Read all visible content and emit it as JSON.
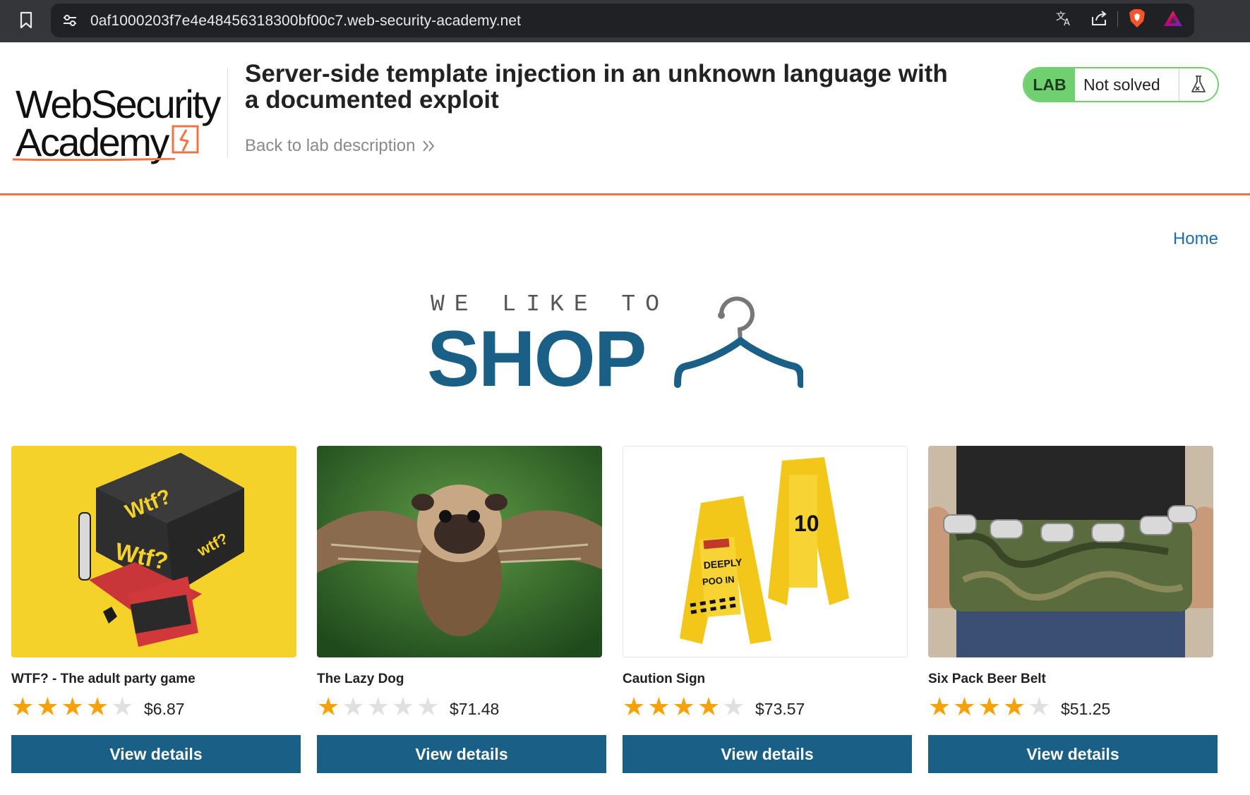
{
  "browser": {
    "url": "0af1000203f7e4e48456318300bf00c7.web-security-academy.net"
  },
  "lab": {
    "logo_line1": "WebSecurity",
    "logo_line2": "Academy",
    "title": "Server-side template injection in an unknown language with a documented exploit",
    "back_link": "Back to lab description",
    "badge_label": "LAB",
    "status": "Not solved"
  },
  "nav": {
    "home": "Home"
  },
  "banner": {
    "tagline": "WE LIKE TO",
    "word": "SHOP"
  },
  "products": [
    {
      "name": "WTF? - The adult party game",
      "rating": 4,
      "price": "$6.87",
      "button": "View details"
    },
    {
      "name": "The Lazy Dog",
      "rating": 1,
      "price": "$71.48",
      "button": "View details"
    },
    {
      "name": "Caution Sign",
      "rating": 4,
      "price": "$73.57",
      "button": "View details"
    },
    {
      "name": "Six Pack Beer Belt",
      "rating": 4,
      "price": "$51.25",
      "button": "View details"
    }
  ],
  "colors": {
    "accent": "#1a5f86",
    "rule": "#ee7444",
    "lab_badge": "#70d070",
    "star": "#f5a20a"
  },
  "icons": [
    "bookmark-icon",
    "site-info-icon",
    "translate-icon",
    "share-icon",
    "brave-shield-icon",
    "rewards-icon",
    "flask-icon",
    "chevron-right-icon",
    "hanger-icon"
  ]
}
